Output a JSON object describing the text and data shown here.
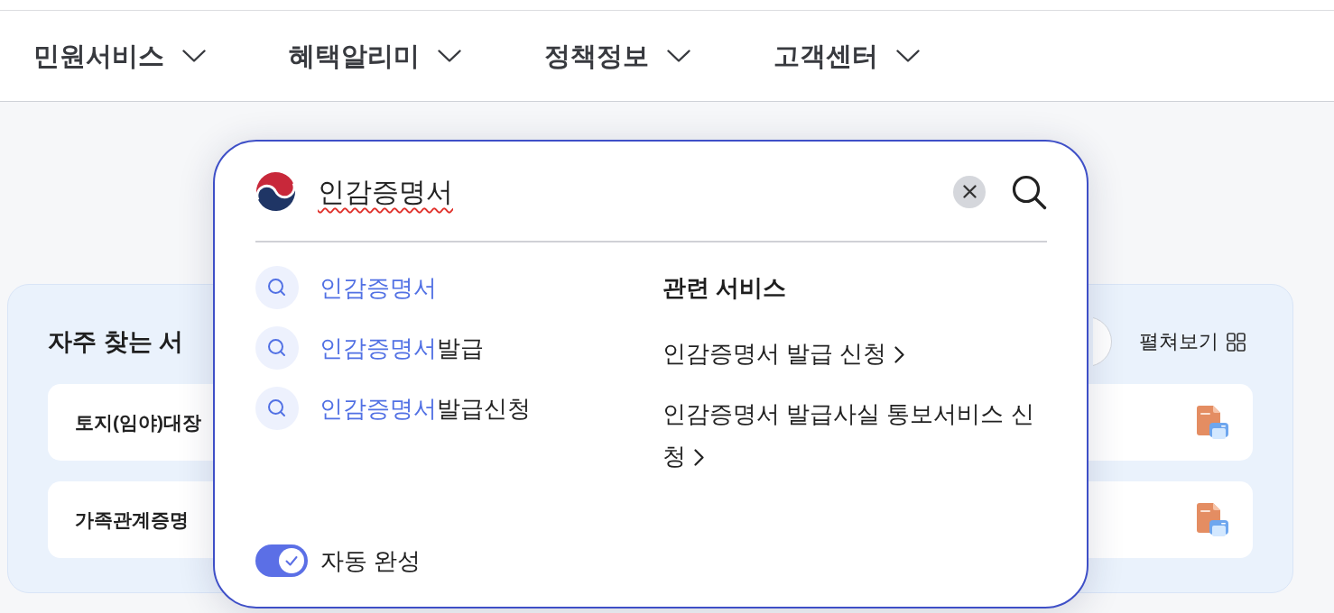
{
  "nav": {
    "items": [
      {
        "label": "민원서비스"
      },
      {
        "label": "혜택알리미"
      },
      {
        "label": "정책정보"
      },
      {
        "label": "고객센터"
      }
    ]
  },
  "frequent_services": {
    "title": "자주 찾는 서",
    "expand_label": "펼쳐보기",
    "cards": [
      {
        "label": "토지(임야)대장"
      },
      {
        "label": "가족관계증명"
      }
    ]
  },
  "search": {
    "value": "인감증명서",
    "spell_error": true,
    "suggestions": [
      {
        "match": "인감증명서"
      },
      {
        "match": "인감증명서",
        "rest": "발급"
      },
      {
        "match": "인감증명서",
        "rest": "발급신청"
      }
    ],
    "related": {
      "title": "관련 서비스",
      "links": [
        {
          "label": "인감증명서 발급 신청"
        },
        {
          "label": "인감증명서 발급사실 통보서비스 신청"
        }
      ]
    },
    "autocomplete": {
      "label": "자동 완성",
      "on": true
    }
  }
}
